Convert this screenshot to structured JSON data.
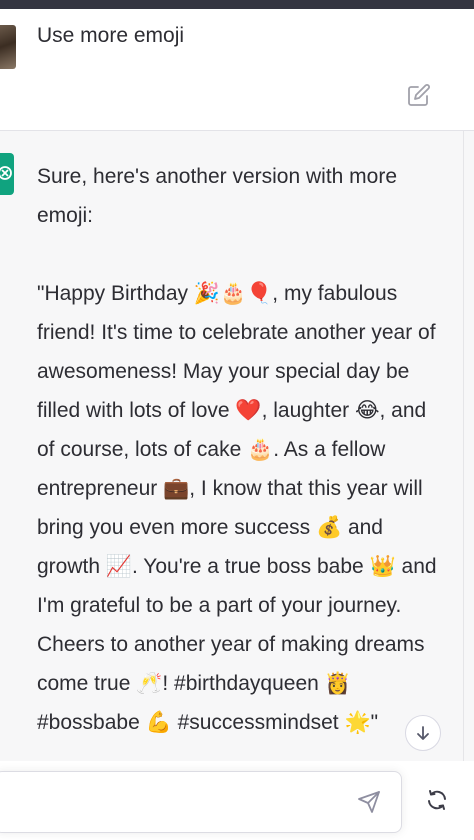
{
  "user_message": {
    "text": "Use more emoji"
  },
  "assistant_message": {
    "intro": "Sure, here's another version with more emoji:",
    "body": "\"Happy Birthday 🎉🎂🎈, my fabulous friend! It's time to celebrate another year of awesomeness! May your special day be filled with lots of love ❤️, laughter 😂, and of course, lots of cake 🎂. As a fellow entrepreneur 💼, I know that this year will bring you even more success 💰 and growth 📈. You're a true boss babe 👑 and I'm grateful to be a part of your journey. Cheers to another year of making dreams come true 🥂! #birthdayqueen 👸 #bossbabe 💪 #successmindset 🌟\""
  },
  "composer": {
    "placeholder": "",
    "value": ""
  },
  "icons": {
    "edit": "edit-icon",
    "bot": "openai-logo-icon",
    "scroll_down": "arrow-down-icon",
    "send": "send-icon",
    "regenerate": "regenerate-icon"
  },
  "colors": {
    "accent": "#10a37f",
    "topbar": "#343541",
    "assistant_bg": "#f7f7f8",
    "text": "#2d2d33"
  }
}
